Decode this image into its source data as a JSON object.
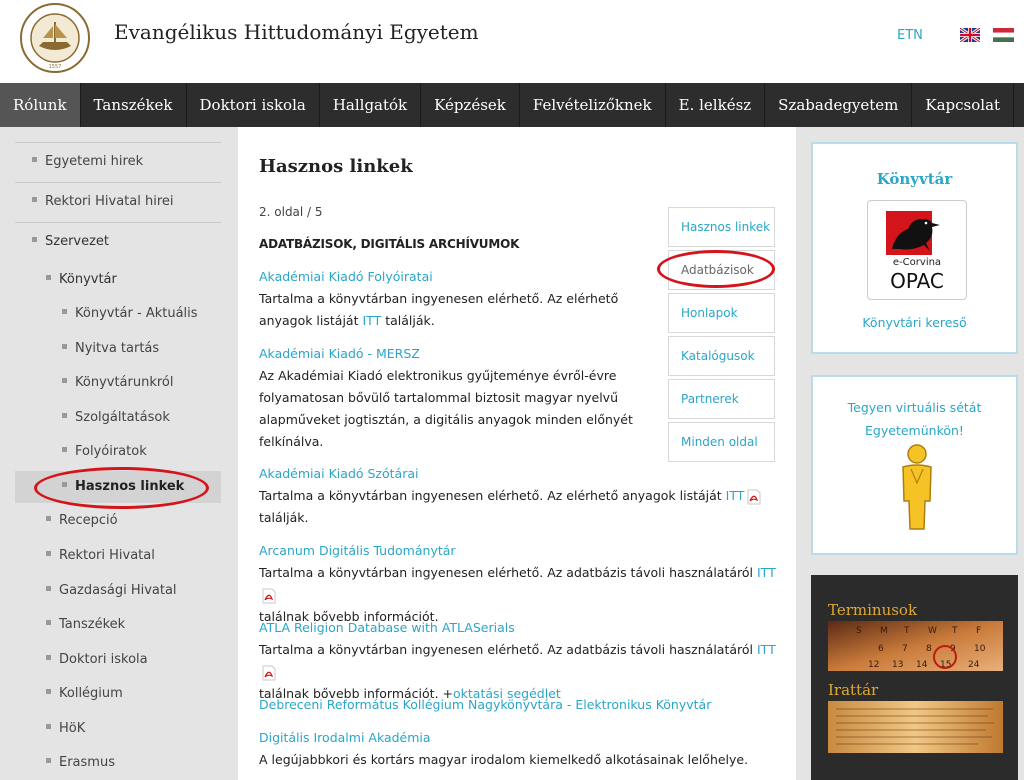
{
  "header": {
    "site_title": "Evangélikus Hittudományi Egyetem",
    "lang_etn": "ETN",
    "logo_text": "EVANGÉLIKUS HITTUDOMÁNYI EGYETEM 1557"
  },
  "nav": {
    "items": [
      "Rólunk",
      "Tanszékek",
      "Doktori iskola",
      "Hallgatók",
      "Képzések",
      "Felvételizőknek",
      "E. lelkész",
      "Szabadegyetem",
      "Kapcsolat"
    ],
    "active_index": 0
  },
  "sidebar": {
    "items": [
      {
        "label": "Egyetemi hirek"
      },
      {
        "label": "Rektori Hivatal hirei"
      },
      {
        "label": "Szervezet"
      },
      {
        "label": "Könyvtár"
      },
      {
        "label": "Könyvtár - Aktuális"
      },
      {
        "label": "Nyitva tartás"
      },
      {
        "label": "Könyvtárunkról"
      },
      {
        "label": "Szolgáltatások"
      },
      {
        "label": "Folyóiratok"
      },
      {
        "label": "Hasznos linkek"
      },
      {
        "label": "Recepció"
      },
      {
        "label": "Rektori Hivatal"
      },
      {
        "label": "Gazdasági Hivatal"
      },
      {
        "label": "Tanszékek"
      },
      {
        "label": "Doktori iskola"
      },
      {
        "label": "Kollégium"
      },
      {
        "label": "HöK"
      },
      {
        "label": "Erasmus"
      }
    ],
    "active_label": "Hasznos linkek"
  },
  "main": {
    "title": "Hasznos linkek",
    "page_indicator": "2. oldal / 5",
    "section_heading": "ADATBÁZISOK, DIGITÁLIS ARCHÍVUMOK",
    "entries": [
      {
        "title": "Akadémiai Kiadó Folyóiratai",
        "text_a": "Tartalma a könyvtárban ingyenesen elérhető. Az elérhető anyagok listáját ",
        "link": "ITT",
        "text_b": " találják."
      },
      {
        "title": "Akadémiai Kiadó - MERSZ",
        "text": "Az Akadémiai Kiadó elektronikus gyűjteménye évről-évre folyamatosan bővülő tartalommal biztosit magyar nyelvű alapműveket jogtisztán, a digitális anyagok minden előnyét felkínálva."
      },
      {
        "title": "Akadémiai Kiadó Szótárai",
        "text_a": "Tartalma a könyvtárban ingyenesen elérhető. Az elérhető anyagok listáját ",
        "link": "ITT",
        "text_b": "találják."
      },
      {
        "title": "Arcanum Digitális Tudománytár",
        "text_a": "Tartalma a könyvtárban ingyenesen elérhető. Az adatbázis távoli használatáról ",
        "link": "ITT",
        "text_b": "találnak bővebb információt."
      },
      {
        "title": "ATLA Religion Database with ATLASerials",
        "text_a": "Tartalma a könyvtárban ingyenesen elérhető. Az adatbázis távoli használatáról ",
        "link": "ITT",
        "text_b": "találnak bővebb információt. +",
        "link2": "oktatási segédlet"
      },
      {
        "title": "Debreceni Református Kollégium Nagykönyvtára - Elektronikus Könyvtár"
      },
      {
        "title": "Digitális Irodalmi Akadémia",
        "text": "A legújabbkori és kortárs magyar irodalom kiemelkedő alkotásainak lelőhelye."
      }
    ]
  },
  "subnav": {
    "items": [
      "Hasznos linkek",
      "Adatbázisok",
      "Honlapok",
      "Katalógusok",
      "Partnerek",
      "Minden oldal"
    ],
    "active_label": "Adatbázisok"
  },
  "right": {
    "konyvtar_title": "Könyvtár",
    "opac_top": "e-Corvina",
    "opac_bottom": "OPAC",
    "konyvtar_link": "Könyvtári kereső",
    "virtual_line1": "Tegyen virtuális sétát",
    "virtual_line2": "Egyetemünkön!",
    "terminusok": "Terminusok",
    "irattar": "Irattár"
  },
  "colors": {
    "accent": "#2aa6c8",
    "nav_bg": "#2d2d2d",
    "highlight_red": "#d4141b",
    "gold": "#e0a832"
  }
}
